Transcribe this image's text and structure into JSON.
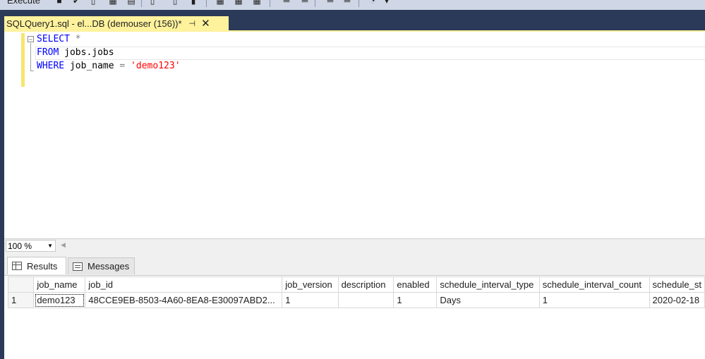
{
  "toolbar": {
    "execute_label": "Execute",
    "icons": [
      "stop-icon",
      "check-icon",
      "parse-icon",
      "display-plan-icon",
      "results-to-icon",
      "comment-icon",
      "uncomment-icon",
      "indent-icon",
      "outdent-icon",
      "specify-values-icon"
    ]
  },
  "editor_tab": {
    "title": "SQLQuery1.sql - el...DB (demouser (156))*",
    "pin_glyph": "⊣",
    "close_glyph": "✕"
  },
  "editor": {
    "lines": [
      {
        "kw": "SELECT",
        "rest_gray": " *",
        "rest": "",
        "str": ""
      },
      {
        "kw": "FROM",
        "rest_gray": "",
        "rest": " jobs.jobs",
        "str": ""
      },
      {
        "kw": "WHERE",
        "rest_gray": "",
        "rest": " job_name ",
        "op": "=",
        "str": " 'demo123'"
      }
    ],
    "collapse_glyph": "−"
  },
  "zoom": {
    "value": "100 %"
  },
  "result_tabs": [
    {
      "label": "Results",
      "active": true
    },
    {
      "label": "Messages",
      "active": false
    }
  ],
  "grid": {
    "columns": [
      "job_name",
      "job_id",
      "job_version",
      "description",
      "enabled",
      "schedule_interval_type",
      "schedule_interval_count",
      "schedule_st"
    ],
    "rows": [
      {
        "num": "1",
        "cells": [
          "demo123",
          "48CCE9EB-8503-4A60-8EA8-E30097ABD2...",
          "1",
          "",
          "1",
          "Days",
          "1",
          "2020-02-18"
        ]
      }
    ]
  },
  "colors": {
    "tab_active": "#fff29d",
    "keyword": "#0000ff",
    "string": "#ff0000",
    "chrome_dark": "#2b3a58"
  }
}
